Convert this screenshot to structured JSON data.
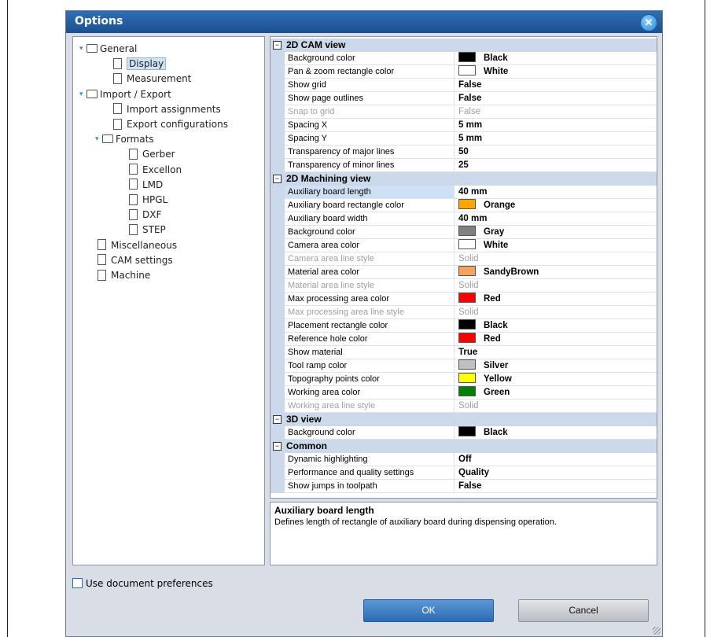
{
  "window": {
    "title": "Options",
    "close_icon": "close-icon"
  },
  "tree": [
    {
      "label": "General",
      "type": "folder",
      "expanded": true,
      "level": 0
    },
    {
      "label": "Display",
      "type": "page",
      "level": 1,
      "selected": true
    },
    {
      "label": "Measurement",
      "type": "page",
      "level": 1
    },
    {
      "label": "Import / Export",
      "type": "folder",
      "expanded": true,
      "level": 0
    },
    {
      "label": "Import assignments",
      "type": "page",
      "level": 1
    },
    {
      "label": "Export configurations",
      "type": "page",
      "level": 1
    },
    {
      "label": "Formats",
      "type": "folder",
      "expanded": true,
      "level": 1
    },
    {
      "label": "Gerber",
      "type": "page",
      "level": 2
    },
    {
      "label": "Excellon",
      "type": "page",
      "level": 2
    },
    {
      "label": "LMD",
      "type": "page",
      "level": 2
    },
    {
      "label": "HPGL",
      "type": "page",
      "level": 2
    },
    {
      "label": "DXF",
      "type": "page",
      "level": 2
    },
    {
      "label": "STEP",
      "type": "page",
      "level": 2
    },
    {
      "label": "Miscellaneous",
      "type": "page",
      "level": 0
    },
    {
      "label": "CAM settings",
      "type": "page",
      "level": 0
    },
    {
      "label": "Machine",
      "type": "page",
      "level": 0
    }
  ],
  "categories": [
    {
      "name": "2D CAM view",
      "props": [
        {
          "name": "Background color",
          "value": "Black",
          "color": "#000000"
        },
        {
          "name": "Pan & zoom rectangle color",
          "value": "White",
          "color": "#ffffff"
        },
        {
          "name": "Show grid",
          "value": "False"
        },
        {
          "name": "Show page outlines",
          "value": "False"
        },
        {
          "name": "Snap to grid",
          "value": "False",
          "disabled": true
        },
        {
          "name": "Spacing X",
          "value": "5 mm"
        },
        {
          "name": "Spacing Y",
          "value": "5 mm"
        },
        {
          "name": "Transparency of major lines",
          "value": "50"
        },
        {
          "name": "Transparency of minor lines",
          "value": "25"
        }
      ]
    },
    {
      "name": "2D Machining view",
      "props": [
        {
          "name": "Auxiliary board length",
          "value": "40 mm",
          "selected": true
        },
        {
          "name": "Auxiliary board rectangle color",
          "value": "Orange",
          "color": "#ffa500"
        },
        {
          "name": "Auxiliary board width",
          "value": "40 mm"
        },
        {
          "name": "Background color",
          "value": "Gray",
          "color": "#808080"
        },
        {
          "name": "Camera area color",
          "value": "White",
          "color": "#ffffff"
        },
        {
          "name": "Camera area line style",
          "value": "Solid",
          "disabled": true
        },
        {
          "name": "Material area color",
          "value": "SandyBrown",
          "color": "#f4a460"
        },
        {
          "name": "Material area line style",
          "value": "Solid",
          "disabled": true
        },
        {
          "name": "Max processing area color",
          "value": "Red",
          "color": "#ff0000"
        },
        {
          "name": "Max processing area line style",
          "value": "Solid",
          "disabled": true
        },
        {
          "name": "Placement rectangle color",
          "value": "Black",
          "color": "#000000"
        },
        {
          "name": "Reference hole color",
          "value": "Red",
          "color": "#ff0000"
        },
        {
          "name": "Show material",
          "value": "True"
        },
        {
          "name": "Tool ramp color",
          "value": "Silver",
          "color": "#c0c0c0"
        },
        {
          "name": "Topography points color",
          "value": "Yellow",
          "color": "#ffff00"
        },
        {
          "name": "Working area color",
          "value": "Green",
          "color": "#008000"
        },
        {
          "name": "Working area line style",
          "value": "Solid",
          "disabled": true
        }
      ]
    },
    {
      "name": "3D view",
      "props": [
        {
          "name": "Background color",
          "value": "Black",
          "color": "#000000"
        }
      ]
    },
    {
      "name": "Common",
      "props": [
        {
          "name": "Dynamic highlighting",
          "value": "Off"
        },
        {
          "name": "Performance and quality settings",
          "value": "Quality"
        },
        {
          "name": "Show jumps in toolpath",
          "value": "False"
        }
      ]
    }
  ],
  "description": {
    "title": "Auxiliary board length",
    "text": "Defines length of rectangle of auxiliary board during dispensing operation."
  },
  "use_doc_prefs": {
    "label": "Use document preferences",
    "checked": false
  },
  "buttons": {
    "ok": "OK",
    "cancel": "Cancel"
  },
  "colors": {
    "title_bar": "#2563a8",
    "category_bg": "#ccd9ea",
    "ok_button": "#3b7ec6"
  }
}
